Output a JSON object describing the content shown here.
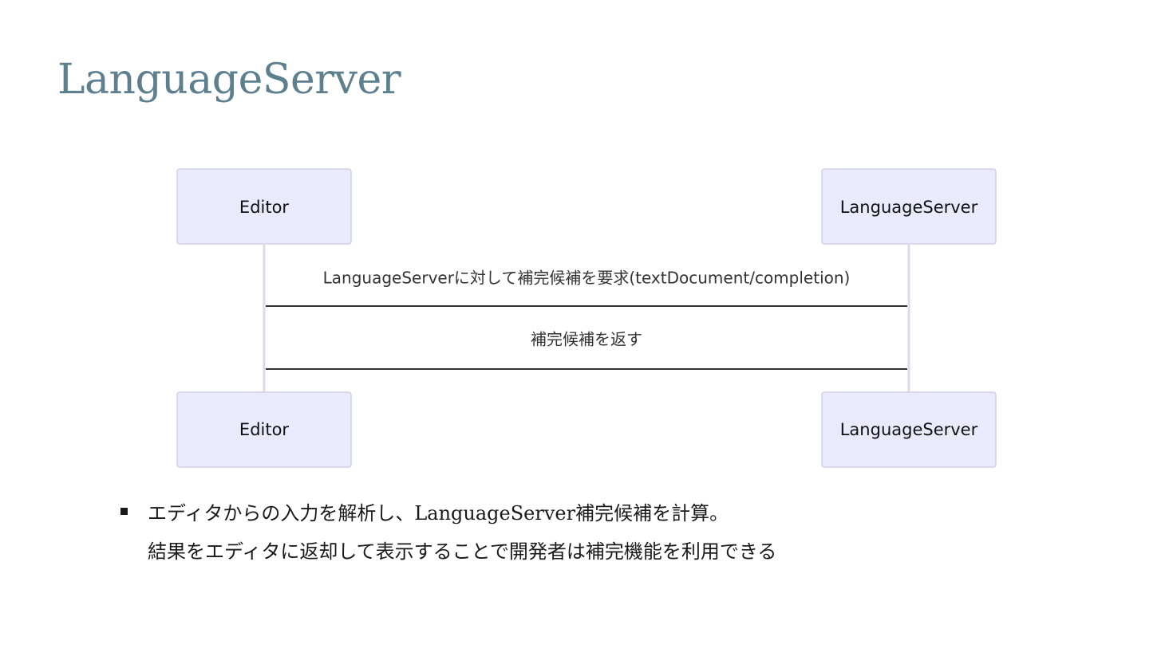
{
  "title": "LanguageServer",
  "diagram": {
    "participants": [
      {
        "id": "editor",
        "label": "Editor"
      },
      {
        "id": "server",
        "label": "LanguageServer"
      }
    ],
    "messages": [
      {
        "from": "editor",
        "to": "server",
        "label": "LanguageServerに対して補完候補を要求(textDocument/completion)"
      },
      {
        "from": "server",
        "to": "editor",
        "label": "補完候補を返す"
      }
    ],
    "colors": {
      "actor_fill": "#eaeafd",
      "actor_border": "#d3d0ea",
      "lifeline": "#e0d8ec",
      "message_line": "#333333"
    }
  },
  "bullets": [
    {
      "lines": [
        "エディタからの入力を解析し、LanguageServer補完候補を計算。",
        "結果をエディタに返却して表示することで開発者は補完機能を利用できる"
      ]
    }
  ]
}
